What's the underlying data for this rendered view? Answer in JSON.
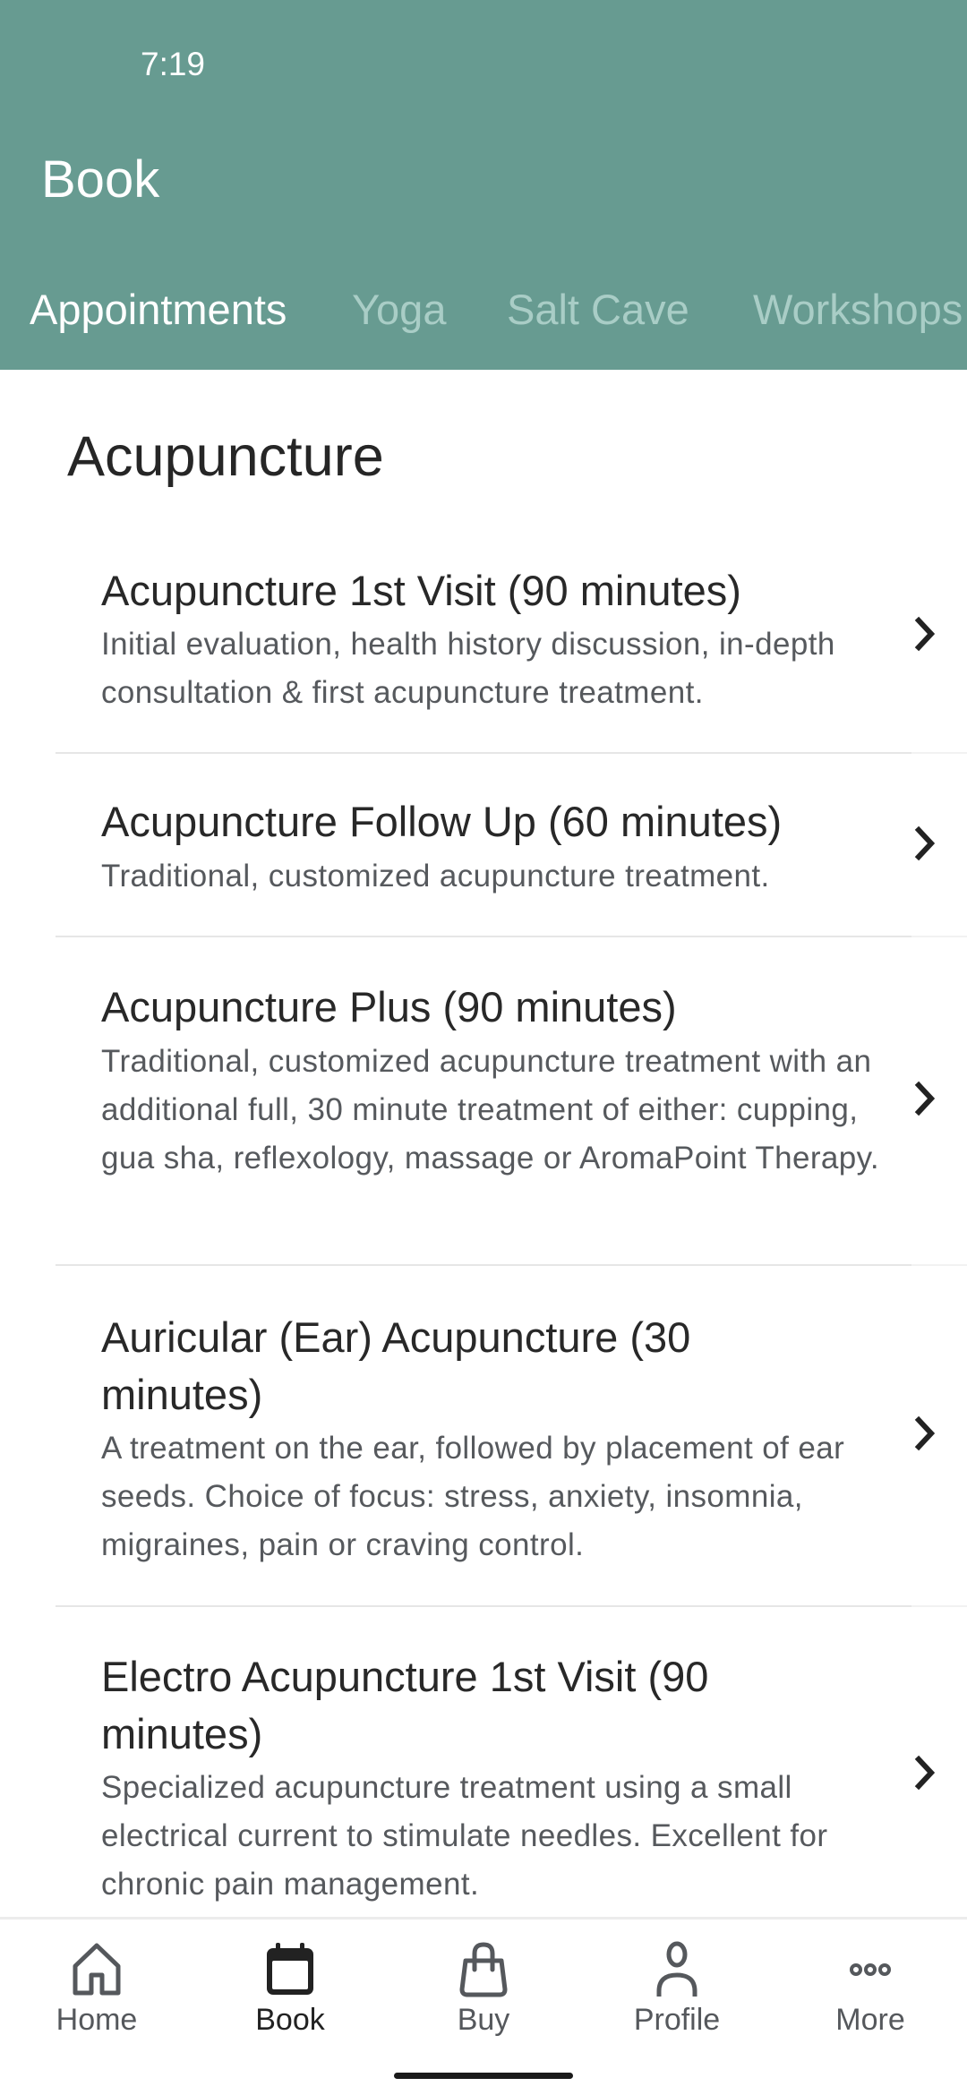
{
  "status_bar": {
    "time": "7:19"
  },
  "header": {
    "title": "Book",
    "background_color": "#679b91",
    "tabs": [
      {
        "label": "Appointments",
        "active": true
      },
      {
        "label": "Yoga",
        "active": false
      },
      {
        "label": "Salt Cave",
        "active": false
      },
      {
        "label": "Workshops",
        "active": false
      }
    ]
  },
  "section": {
    "title": "Acupuncture",
    "items": [
      {
        "title": "Acupuncture 1st Visit (90 minutes)",
        "description": "Initial evaluation, health history discussion, in-depth consultation & first acupuncture treatment.",
        "icon": "chevron-right-icon"
      },
      {
        "title": "Acupuncture Follow Up (60 minutes)",
        "description": "Traditional, customized acupuncture treatment.",
        "icon": "chevron-right-icon"
      },
      {
        "title": "Acupuncture Plus (90 minutes)",
        "description": "Traditional, customized acupuncture treatment with an additional full, 30 minute treatment of either: cupping, gua sha, reflexology, massage or AromaPoint Therapy.",
        "icon": "chevron-right-icon"
      },
      {
        "title": "Auricular (Ear) Acupuncture (30 minutes)",
        "description": "A treatment on the ear, followed by placement of ear seeds. Choice of focus: stress, anxiety, insomnia, migraines, pain or craving control.",
        "icon": "chevron-right-icon"
      },
      {
        "title": "Electro Acupuncture 1st Visit (90 minutes)",
        "description": "Specialized acupuncture treatment using a small electrical current to stimulate needles. Excellent for chronic pain management.",
        "icon": "chevron-right-icon"
      }
    ]
  },
  "bottom_nav": {
    "items": [
      {
        "label": "Home",
        "icon": "home-icon",
        "active": false
      },
      {
        "label": "Book",
        "icon": "calendar-icon",
        "active": true
      },
      {
        "label": "Buy",
        "icon": "shopping-bag-icon",
        "active": false
      },
      {
        "label": "Profile",
        "icon": "person-icon",
        "active": false
      },
      {
        "label": "More",
        "icon": "more-dots-icon",
        "active": false
      }
    ]
  }
}
